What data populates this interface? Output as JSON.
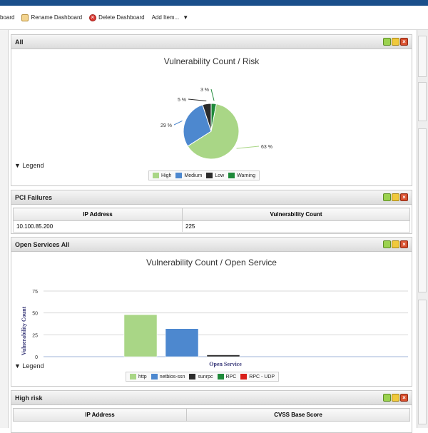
{
  "toolbar": {
    "partial_label": "board",
    "rename_label": "Rename Dashboard",
    "delete_label": "Delete Dashboard",
    "add_label": "Add Item...",
    "add_caret": "▼"
  },
  "panels": {
    "all": {
      "title": "All",
      "chart_title": "Vulnerability Count / Risk",
      "legend_toggle": "Legend"
    },
    "pci": {
      "title": "PCI Failures",
      "columns": [
        "IP Address",
        "Vulnerability Count"
      ],
      "rows": [
        [
          "10.100.85.200",
          "225"
        ]
      ]
    },
    "open_services": {
      "title": "Open Services All",
      "chart_title": "Vulnerability Count / Open Service",
      "legend_toggle": "Legend"
    },
    "high_risk": {
      "title": "High risk",
      "columns": [
        "IP Address",
        "CVSS Base Score"
      ]
    }
  },
  "panel_buttons": [
    "restore-icon",
    "settings-icon",
    "close-icon"
  ],
  "chart_data": [
    {
      "type": "pie",
      "title": "Vulnerability Count / Risk",
      "slices": [
        {
          "name": "High",
          "value": 63,
          "label": "63 %",
          "color": "#a9d686"
        },
        {
          "name": "Medium",
          "value": 29,
          "label": "29 %",
          "color": "#4d88cf"
        },
        {
          "name": "Low",
          "value": 5,
          "label": "5 %",
          "color": "#2b2b2b"
        },
        {
          "name": "Warning",
          "value": 3,
          "label": "3 %",
          "color": "#1f8a3a"
        }
      ],
      "legend": "bottom"
    },
    {
      "type": "bar",
      "title": "Vulnerability Count / Open Service",
      "xlabel": "Open Service",
      "ylabel": "Vulnerability Count",
      "ylim": [
        0,
        75
      ],
      "yticks": [
        0,
        25,
        50,
        75
      ],
      "categories": [
        "http",
        "netbios-ssn",
        "sunrpc",
        "RPC",
        "RPC - UDP"
      ],
      "values": [
        48,
        32,
        2,
        0,
        0
      ],
      "colors": [
        "#a9d686",
        "#4d88cf",
        "#2b2b2b",
        "#1f8a3a",
        "#d9201b"
      ],
      "grid": true,
      "legend": "bottom"
    }
  ]
}
